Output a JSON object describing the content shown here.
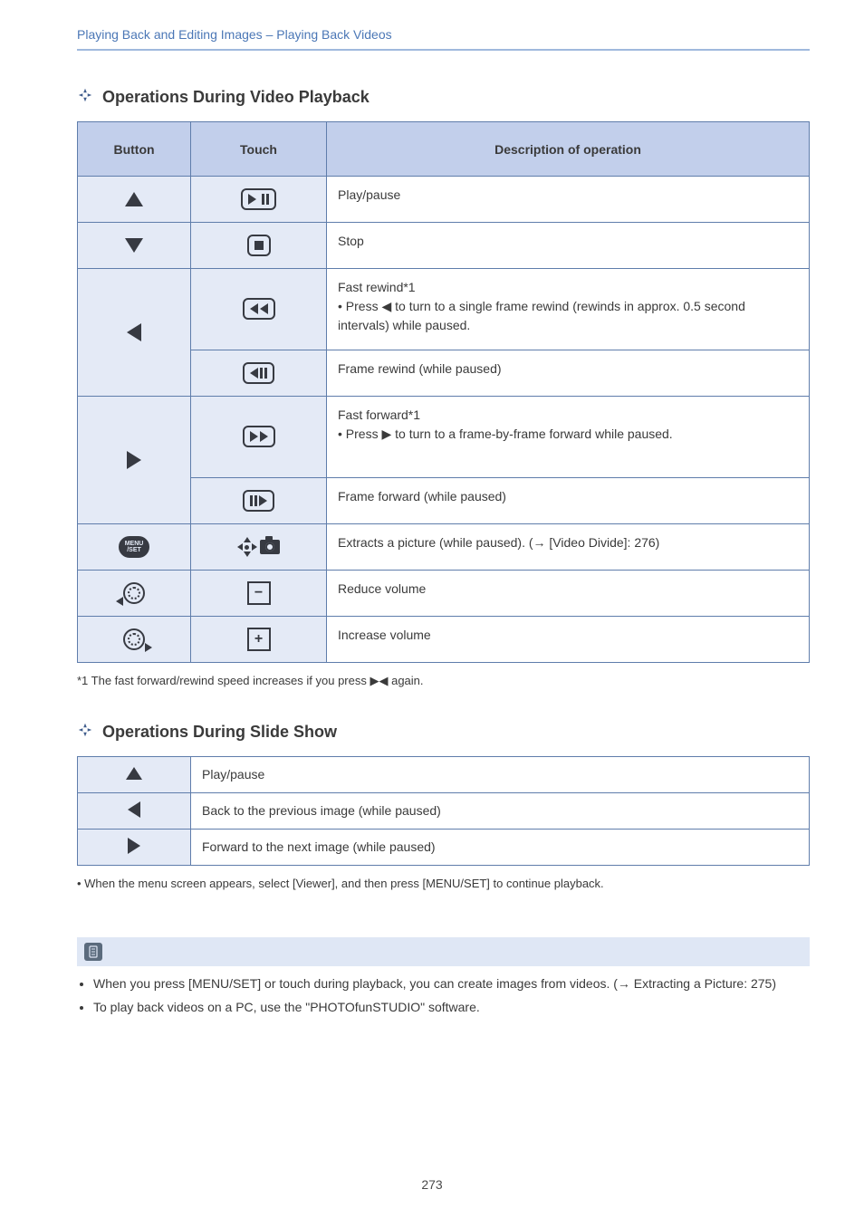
{
  "breadcrumb": "Playing Back and Editing Images – Playing Back Videos",
  "section1": {
    "title": "Operations During Video Playback",
    "headers": {
      "button": "Button",
      "touch": "Touch",
      "desc": "Description of operation"
    },
    "rows": {
      "up": "Play/pause",
      "down": "Stop",
      "left_ff": "Fast rewind*1\n• Press ◀ to turn to a single frame rewind (rewinds in approx. 0.5 second intervals) while paused.",
      "left_frame": "Frame rewind (while paused)",
      "right_ff": "Fast forward*1\n• Press ▶ to turn to a frame-by-frame forward while paused.",
      "right_frame": "Frame forward (while paused)",
      "menuset": "Extracts a picture (while paused). (→ [Video Divide]: 276)",
      "dial_ccw": "Reduce volume",
      "dial_cw": "Increase volume"
    },
    "footnote": "*1 The fast forward/rewind speed increases if you press ▶◀ again."
  },
  "section2": {
    "title": "Operations During Slide Show",
    "rows": {
      "up": "Play/pause",
      "left": "Back to the previous image (while paused)",
      "right": "Forward to the next image (while paused)"
    },
    "footnote": "• When the menu screen appears, select [Viewer], and then press [MENU/SET] to continue playback."
  },
  "notes": [
    "When you press [MENU/SET] or touch during playback, you can create images from videos. (→ Extracting a Picture: 275)",
    "To play back videos on a PC, use the \"PHOTOfunSTUDIO\" software."
  ],
  "pagenum": "273"
}
